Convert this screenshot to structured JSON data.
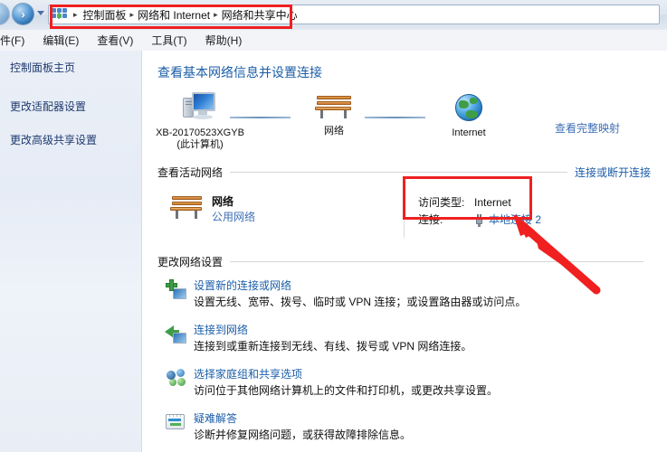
{
  "window": {
    "nav": {
      "back_label": "‹",
      "forward_label": "›",
      "history_label": "history-dropdown",
      "address_icon": "network-sharing-icon"
    },
    "breadcrumbs": [
      {
        "label": "控制面板"
      },
      {
        "label": "网络和 Internet"
      },
      {
        "label": "网络和共享中心"
      }
    ],
    "separator": "▸",
    "menus": [
      {
        "label": "件(F)"
      },
      {
        "label": "编辑(E)"
      },
      {
        "label": "查看(V)"
      },
      {
        "label": "工具(T)"
      },
      {
        "label": "帮助(H)"
      }
    ]
  },
  "sidebar": {
    "items": [
      {
        "label": "控制面板主页",
        "icon": "home-link"
      },
      {
        "label": "更改适配器设置",
        "icon": "adapter-link"
      },
      {
        "label": "更改高级共享设置",
        "icon": "sharing-link"
      }
    ]
  },
  "main": {
    "heading": "查看基本网络信息并设置连接",
    "map": {
      "view_full_map": "查看完整映射",
      "nodes": [
        {
          "label": "XB-20170523XGYB",
          "sublabel": "(此计算机)",
          "icon": "computer-icon"
        },
        {
          "label": "网络",
          "sublabel": "",
          "icon": "network-bench-icon"
        },
        {
          "label": "Internet",
          "sublabel": "",
          "icon": "globe-icon"
        }
      ]
    },
    "active_networks": {
      "section_title": "查看活动网络",
      "action_link": "连接或断开连接",
      "network": {
        "name": "网络",
        "profile": "公用网络",
        "icon": "network-bench-icon",
        "access_type_label": "访问类型:",
        "access_type_value": "Internet",
        "connection_label": "连接:",
        "connection_value": "本地连接 2",
        "connection_icon": "network-plug-icon"
      }
    },
    "change_settings": {
      "section_title": "更改网络设置",
      "items": [
        {
          "icon": "new-connection-icon",
          "title": "设置新的连接或网络",
          "desc": "设置无线、宽带、拨号、临时或 VPN 连接；或设置路由器或访问点。"
        },
        {
          "icon": "connect-network-icon",
          "title": "连接到网络",
          "desc": "连接到或重新连接到无线、有线、拨号或 VPN 网络连接。"
        },
        {
          "icon": "homegroup-icon",
          "title": "选择家庭组和共享选项",
          "desc": "访问位于其他网络计算机上的文件和打印机，或更改共享设置。"
        },
        {
          "icon": "troubleshoot-icon",
          "title": "疑难解答",
          "desc": "诊断并修复网络问题，或获得故障排除信息。"
        }
      ]
    }
  },
  "annotations": {
    "color": "#f02020",
    "boxes": [
      {
        "name": "breadcrumb-highlight"
      },
      {
        "name": "connection-info-highlight"
      }
    ],
    "arrow": {
      "name": "pointer-arrow",
      "points_to": "connection-info-highlight"
    }
  }
}
